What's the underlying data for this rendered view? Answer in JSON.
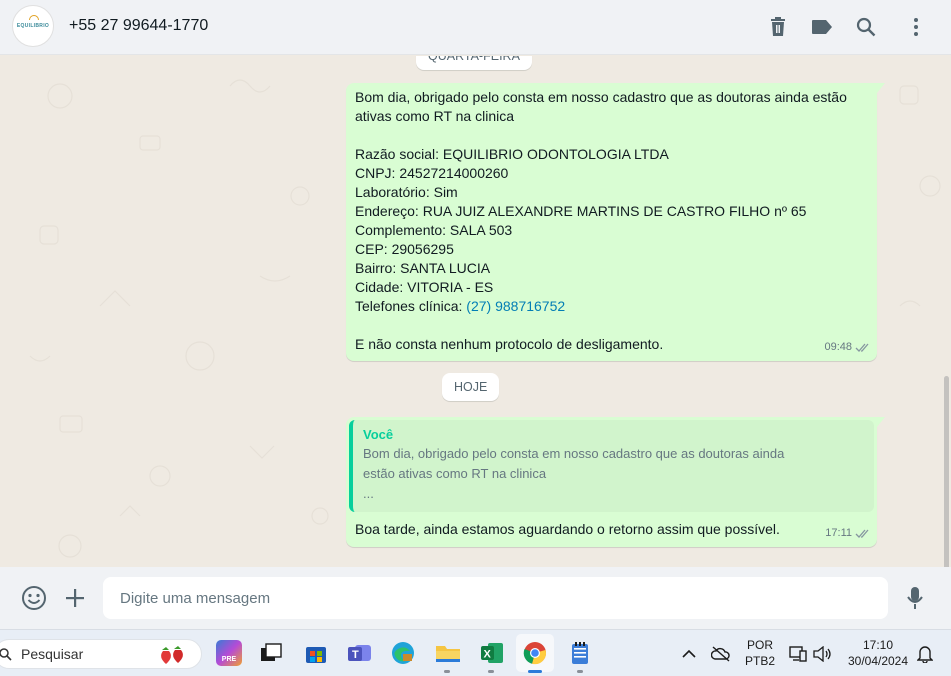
{
  "header": {
    "avatar_text": "EQUILIBRIO",
    "contact": "+55 27 99644-1770",
    "icons": [
      "delete-icon",
      "label-icon",
      "search-icon",
      "menu-icon"
    ]
  },
  "chat": {
    "top_pill": "QUARTA-FEIRA",
    "message1": {
      "lines": [
        "Bom dia, obrigado pelo consta em nosso cadastro que as doutoras ainda estão",
        "ativas como RT na clinica",
        "",
        "Razão social: EQUILIBRIO ODONTOLOGIA LTDA",
        "CNPJ: 24527214000260",
        "Laboratório: Sim",
        "Endereço: RUA JUIZ ALEXANDRE MARTINS DE CASTRO FILHO nº 65",
        "Complemento: SALA 503",
        "CEP: 29056295",
        "Bairro: SANTA LUCIA",
        "Cidade: VITORIA - ES"
      ],
      "phone_label": "Telefones clínica: ",
      "phone_link": "(27) 988716752",
      "last_line": "E não consta nenhum protocolo de desligamento.",
      "time": "09:48"
    },
    "today_pill": "HOJE",
    "message2": {
      "quote_author": "Você",
      "quote_line1": "Bom dia, obrigado pelo consta em nosso cadastro que as doutoras ainda",
      "quote_line2": "estão ativas como RT na clinica",
      "quote_line3": "...",
      "text": "Boa tarde, ainda estamos aguardando o retorno assim que possível.",
      "time": "17:11"
    }
  },
  "composer": {
    "placeholder": "Digite uma mensagem"
  },
  "taskbar": {
    "search": "Pesquisar",
    "lang_top": "POR",
    "lang_bottom": "PTB2",
    "time": "17:10",
    "date": "30/04/2024"
  },
  "colors": {
    "bubble": "#d9fdd3",
    "link": "#027eb5",
    "quote_accent": "#06cf9c",
    "chat_bg": "#efeae2"
  }
}
